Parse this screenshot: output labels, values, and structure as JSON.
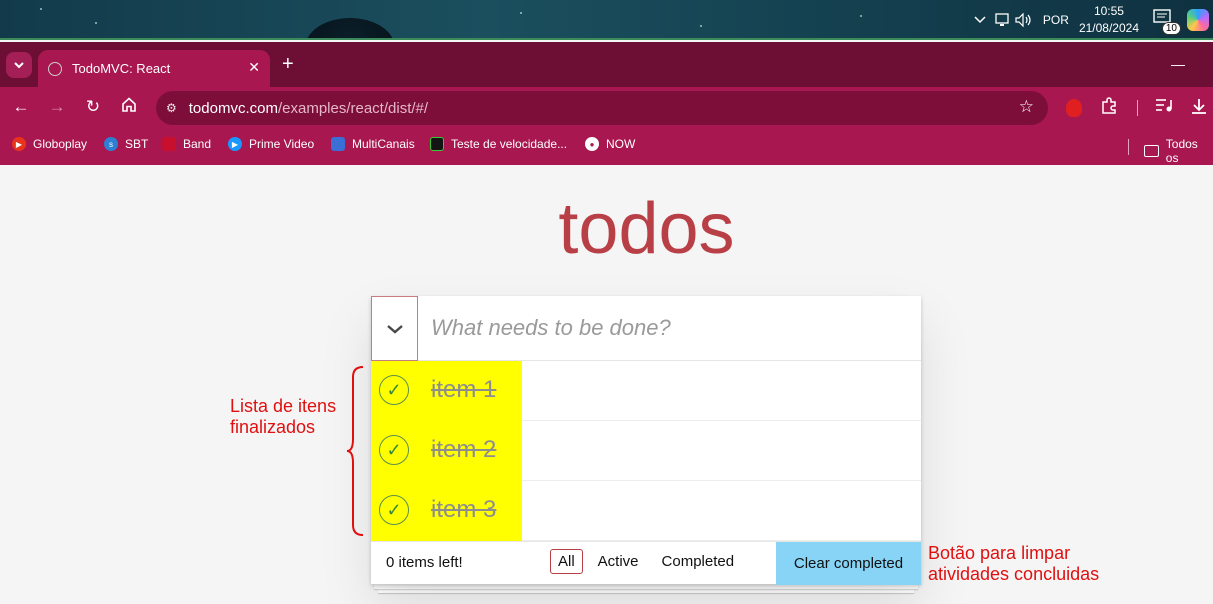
{
  "taskbar": {
    "language": "POR",
    "time": "10:55",
    "date": "21/08/2024",
    "notification_count": "10"
  },
  "browser": {
    "tab_title": "TodoMVC: React",
    "url_host": "todomvc.com",
    "url_path": "/examples/react/dist/#/",
    "bookmarks": [
      {
        "label": "Globoplay",
        "color": "#e8341c"
      },
      {
        "label": "SBT",
        "color": "#2d7fd3"
      },
      {
        "label": "Band",
        "color": "#c8102e"
      },
      {
        "label": "Prime Video",
        "color": "#1a98ff"
      },
      {
        "label": "MultiCanais",
        "color": "#3a6fd8"
      },
      {
        "label": "Teste de velocidade...",
        "color": "#141414"
      },
      {
        "label": "NOW",
        "color": "#ffffff"
      }
    ],
    "bookmarks_folder": "Todos os"
  },
  "app": {
    "title": "todos",
    "new_todo_placeholder": "What needs to be done?",
    "items": [
      {
        "label": "item 1",
        "completed": true
      },
      {
        "label": "item 2",
        "completed": true
      },
      {
        "label": "item 3",
        "completed": true
      }
    ],
    "footer": {
      "count": "0 items left!",
      "filters": [
        "All",
        "Active",
        "Completed"
      ],
      "selected_filter": "All",
      "clear_label": "Clear completed"
    }
  },
  "annotations": {
    "list_note": [
      "Lista de itens",
      "finalizados"
    ],
    "clear_note": [
      "Botão para limpar",
      "atividades concluidas"
    ]
  },
  "colors": {
    "accent": "#b83f45",
    "highlight": "#ffff00",
    "clear_highlight": "#87d4f7",
    "annotation": "#e01010",
    "browser_frame": "#a8174f"
  }
}
